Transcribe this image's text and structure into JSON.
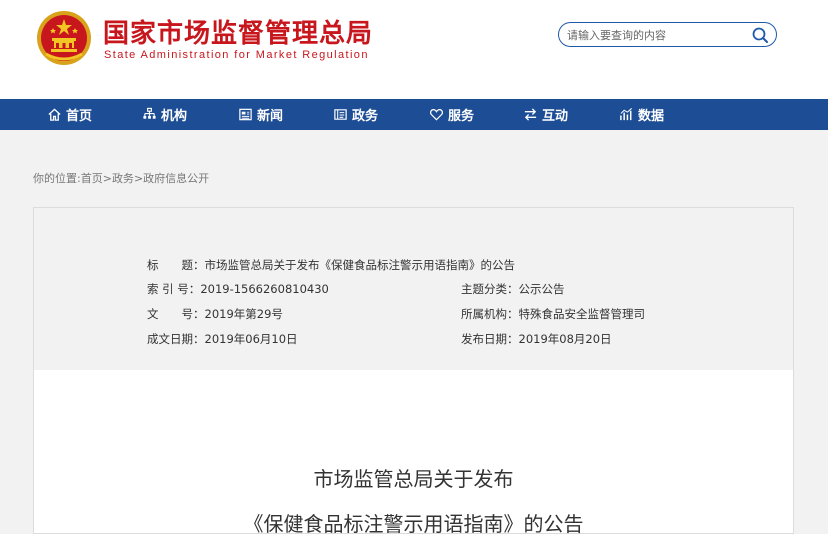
{
  "header": {
    "title": "国家市场监督管理总局",
    "subtitle": "State Administration for Market Regulation",
    "search_placeholder": "请输入要查询的内容"
  },
  "nav": {
    "items": [
      {
        "label": "首页",
        "icon": "home-icon"
      },
      {
        "label": "机构",
        "icon": "org-chart-icon"
      },
      {
        "label": "新闻",
        "icon": "news-icon"
      },
      {
        "label": "政务",
        "icon": "government-affairs-icon"
      },
      {
        "label": "服务",
        "icon": "heart-icon"
      },
      {
        "label": "互动",
        "icon": "exchange-arrows-icon"
      },
      {
        "label": "数据",
        "icon": "data-chart-icon"
      }
    ]
  },
  "breadcrumb": {
    "prefix": "你的位置:",
    "items": [
      "首页",
      "政务",
      "政府信息公开"
    ],
    "separator": ">"
  },
  "meta": {
    "title_label": "标　　题：",
    "title_value": "市场监管总局关于发布《保健食品标注警示用语指南》的公告",
    "index_label": "索 引 号：",
    "index_value": "2019-1566260810430",
    "topic_label": "主题分类：",
    "topic_value": "公示公告",
    "docno_label": "文　　号：",
    "docno_value": "2019年第29号",
    "agency_label": "所属机构：",
    "agency_value": "特殊食品安全监督管理司",
    "created_label": "成文日期：",
    "created_value": "2019年06月10日",
    "published_label": "发布日期：",
    "published_value": "2019年08月20日"
  },
  "article": {
    "title_line1": "市场监管总局关于发布",
    "title_line2": "《保健食品标注警示用语指南》的公告"
  },
  "colors": {
    "brand_red": "#c8161d",
    "nav_blue": "#1d4d95",
    "page_bg": "#f2f2f2"
  }
}
